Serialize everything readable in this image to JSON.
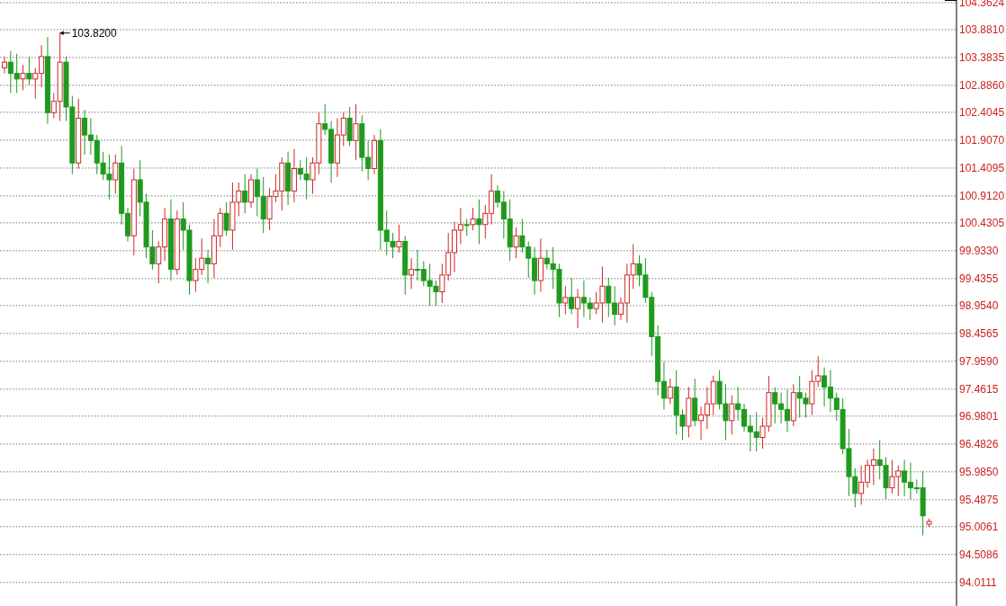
{
  "chart": {
    "chart_data": {
      "type": "candlestick",
      "grid": true,
      "ylim": [
        93.59,
        104.41
      ],
      "yticks": [
        {
          "value": 104.3624,
          "label": "104.3624"
        },
        {
          "value": 103.881,
          "label": "103.8810"
        },
        {
          "value": 103.3835,
          "label": "103.3835"
        },
        {
          "value": 102.886,
          "label": "102.8860"
        },
        {
          "value": 102.4045,
          "label": "102.4045"
        },
        {
          "value": 101.907,
          "label": "101.9070"
        },
        {
          "value": 101.4095,
          "label": "101.4095"
        },
        {
          "value": 100.912,
          "label": "100.9120"
        },
        {
          "value": 100.4305,
          "label": "100.4305"
        },
        {
          "value": 99.933,
          "label": "99.9330"
        },
        {
          "value": 99.4355,
          "label": "99.4355"
        },
        {
          "value": 98.954,
          "label": "98.9540"
        },
        {
          "value": 98.4565,
          "label": "98.4565"
        },
        {
          "value": 97.959,
          "label": "97.9590"
        },
        {
          "value": 97.4615,
          "label": "97.4615"
        },
        {
          "value": 96.9801,
          "label": "96.9801"
        },
        {
          "value": 96.4826,
          "label": "96.4826"
        },
        {
          "value": 95.985,
          "label": "95.9850"
        },
        {
          "value": 95.4875,
          "label": "95.4875"
        },
        {
          "value": 95.0061,
          "label": "95.0061"
        },
        {
          "value": 94.5086,
          "label": "94.5086"
        },
        {
          "value": 94.0111,
          "label": "94.0111"
        }
      ],
      "annotations": [
        {
          "text": "103.8200"
        }
      ],
      "ohlc": [
        [
          103.2,
          103.4,
          103.1,
          103.3
        ],
        [
          103.3,
          103.5,
          102.75,
          103.1
        ],
        [
          103.1,
          103.45,
          102.75,
          103.0
        ],
        [
          103.0,
          103.25,
          102.8,
          103.1
        ],
        [
          103.1,
          103.4,
          102.9,
          103.0
        ],
        [
          103.0,
          103.2,
          102.65,
          103.1
        ],
        [
          103.1,
          103.6,
          102.85,
          103.4
        ],
        [
          103.4,
          103.75,
          102.2,
          102.4
        ],
        [
          102.4,
          102.75,
          102.3,
          102.6
        ],
        [
          102.6,
          103.82,
          102.25,
          103.3
        ],
        [
          103.3,
          103.4,
          102.25,
          102.5
        ],
        [
          102.5,
          102.7,
          101.3,
          101.5
        ],
        [
          101.5,
          102.65,
          101.4,
          102.3
        ],
        [
          102.3,
          102.45,
          101.65,
          102.0
        ],
        [
          102.0,
          102.3,
          101.65,
          101.9
        ],
        [
          101.9,
          102.0,
          101.3,
          101.5
        ],
        [
          101.5,
          101.7,
          101.2,
          101.3
        ],
        [
          101.3,
          101.65,
          100.85,
          101.2
        ],
        [
          101.2,
          101.65,
          100.95,
          101.5
        ],
        [
          101.5,
          101.8,
          100.4,
          100.6
        ],
        [
          100.6,
          100.7,
          100.1,
          100.2
        ],
        [
          100.2,
          101.4,
          99.85,
          101.2
        ],
        [
          101.2,
          101.55,
          100.55,
          100.8
        ],
        [
          100.8,
          100.95,
          99.8,
          100.0
        ],
        [
          100.0,
          100.3,
          99.6,
          99.7
        ],
        [
          99.7,
          100.1,
          99.35,
          100.0
        ],
        [
          100.0,
          100.7,
          99.75,
          100.5
        ],
        [
          100.5,
          100.85,
          99.4,
          99.6
        ],
        [
          99.6,
          100.65,
          99.5,
          100.5
        ],
        [
          100.5,
          100.8,
          99.95,
          100.3
        ],
        [
          100.3,
          100.4,
          99.15,
          99.4
        ],
        [
          99.4,
          99.8,
          99.2,
          99.6
        ],
        [
          99.6,
          100.15,
          99.5,
          99.8
        ],
        [
          99.8,
          99.95,
          99.35,
          99.7
        ],
        [
          99.7,
          100.5,
          99.45,
          100.2
        ],
        [
          100.2,
          100.7,
          100.0,
          100.6
        ],
        [
          100.6,
          100.8,
          100.2,
          100.3
        ],
        [
          100.3,
          101.15,
          99.95,
          100.8
        ],
        [
          100.8,
          101.15,
          100.55,
          101.0
        ],
        [
          101.0,
          101.3,
          100.6,
          100.8
        ],
        [
          100.8,
          101.3,
          100.7,
          101.2
        ],
        [
          101.2,
          101.4,
          100.55,
          100.9
        ],
        [
          100.9,
          101.25,
          100.25,
          100.5
        ],
        [
          100.5,
          101.05,
          100.3,
          100.9
        ],
        [
          100.9,
          101.3,
          100.8,
          101.0
        ],
        [
          101.0,
          101.6,
          100.65,
          101.5
        ],
        [
          101.5,
          101.7,
          100.75,
          101.0
        ],
        [
          101.0,
          101.75,
          100.8,
          101.4
        ],
        [
          101.4,
          101.55,
          101.2,
          101.3
        ],
        [
          101.3,
          101.6,
          100.85,
          101.2
        ],
        [
          101.2,
          101.6,
          100.95,
          101.5
        ],
        [
          101.5,
          102.4,
          101.3,
          102.2
        ],
        [
          102.2,
          102.55,
          102.0,
          102.1
        ],
        [
          102.1,
          102.25,
          101.15,
          101.5
        ],
        [
          101.5,
          102.3,
          101.25,
          102.0
        ],
        [
          102.0,
          102.4,
          101.8,
          102.3
        ],
        [
          102.3,
          102.5,
          101.8,
          101.9
        ],
        [
          101.9,
          102.55,
          101.55,
          102.2
        ],
        [
          102.2,
          102.35,
          101.35,
          101.6
        ],
        [
          101.6,
          101.9,
          101.2,
          101.4
        ],
        [
          101.4,
          102.0,
          101.3,
          101.9
        ],
        [
          101.9,
          102.1,
          99.95,
          100.3
        ],
        [
          100.3,
          100.65,
          99.85,
          100.1
        ],
        [
          100.1,
          100.25,
          99.8,
          100.0
        ],
        [
          100.0,
          100.4,
          99.9,
          100.1
        ],
        [
          100.1,
          100.2,
          99.15,
          99.5
        ],
        [
          99.5,
          99.8,
          99.25,
          99.6
        ],
        [
          99.6,
          99.95,
          99.4,
          99.6
        ],
        [
          99.6,
          99.75,
          99.3,
          99.4
        ],
        [
          99.4,
          99.7,
          98.95,
          99.3
        ],
        [
          99.3,
          99.4,
          98.95,
          99.2
        ],
        [
          99.2,
          99.7,
          99.0,
          99.5
        ],
        [
          99.5,
          100.25,
          99.4,
          99.9
        ],
        [
          99.9,
          100.45,
          99.55,
          100.3
        ],
        [
          100.3,
          100.7,
          100.05,
          100.4
        ],
        [
          100.4,
          100.5,
          100.2,
          100.4
        ],
        [
          100.4,
          100.7,
          100.3,
          100.5
        ],
        [
          100.5,
          100.85,
          100.05,
          100.4
        ],
        [
          100.4,
          100.75,
          100.15,
          100.6
        ],
        [
          100.6,
          101.3,
          100.4,
          101.0
        ],
        [
          101.0,
          101.1,
          100.7,
          100.8
        ],
        [
          100.8,
          101.0,
          100.15,
          100.5
        ],
        [
          100.5,
          100.85,
          99.75,
          100.0
        ],
        [
          100.0,
          100.35,
          99.8,
          100.2
        ],
        [
          100.2,
          100.5,
          99.9,
          100.0
        ],
        [
          100.0,
          100.1,
          99.45,
          99.8
        ],
        [
          99.8,
          100.0,
          99.15,
          99.4
        ],
        [
          99.4,
          100.15,
          99.2,
          99.8
        ],
        [
          99.8,
          99.95,
          99.6,
          99.7
        ],
        [
          99.7,
          100.0,
          99.25,
          99.6
        ],
        [
          99.6,
          99.7,
          98.75,
          99.0
        ],
        [
          99.0,
          99.3,
          98.8,
          99.1
        ],
        [
          99.1,
          99.45,
          98.8,
          98.9
        ],
        [
          98.9,
          99.25,
          98.55,
          99.1
        ],
        [
          99.1,
          99.4,
          98.75,
          99.0
        ],
        [
          99.0,
          99.1,
          98.7,
          98.9
        ],
        [
          98.9,
          99.2,
          98.8,
          99.0
        ],
        [
          99.0,
          99.65,
          98.65,
          99.3
        ],
        [
          99.3,
          99.45,
          98.75,
          99.0
        ],
        [
          99.0,
          99.3,
          98.6,
          98.8
        ],
        [
          98.8,
          99.1,
          98.7,
          99.0
        ],
        [
          99.0,
          99.7,
          98.65,
          99.5
        ],
        [
          99.5,
          100.05,
          99.25,
          99.7
        ],
        [
          99.7,
          99.85,
          99.3,
          99.5
        ],
        [
          99.5,
          99.8,
          99.0,
          99.1
        ],
        [
          99.1,
          99.2,
          98.05,
          98.4
        ],
        [
          98.4,
          98.6,
          97.35,
          97.6
        ],
        [
          97.6,
          97.95,
          97.1,
          97.3
        ],
        [
          97.3,
          97.65,
          97.2,
          97.5
        ],
        [
          97.5,
          97.8,
          96.65,
          97.0
        ],
        [
          97.0,
          97.1,
          96.55,
          96.8
        ],
        [
          96.8,
          97.5,
          96.6,
          97.3
        ],
        [
          97.3,
          97.65,
          96.8,
          96.9
        ],
        [
          96.9,
          97.15,
          96.55,
          97.0
        ],
        [
          97.0,
          97.5,
          96.75,
          97.2
        ],
        [
          97.2,
          97.7,
          97.0,
          97.6
        ],
        [
          97.6,
          97.8,
          97.1,
          97.2
        ],
        [
          97.2,
          97.55,
          96.55,
          96.9
        ],
        [
          96.9,
          97.35,
          96.65,
          97.2
        ],
        [
          97.2,
          97.5,
          96.9,
          97.1
        ],
        [
          97.1,
          97.2,
          96.7,
          96.8
        ],
        [
          96.8,
          97.0,
          96.35,
          96.7
        ],
        [
          96.7,
          97.05,
          96.35,
          96.6
        ],
        [
          96.6,
          96.95,
          96.4,
          96.8
        ],
        [
          96.8,
          97.7,
          96.7,
          97.4
        ],
        [
          97.4,
          97.5,
          96.85,
          97.2
        ],
        [
          97.2,
          97.4,
          96.85,
          97.1
        ],
        [
          97.1,
          97.45,
          96.7,
          96.9
        ],
        [
          96.9,
          97.55,
          96.8,
          97.4
        ],
        [
          97.4,
          97.7,
          96.95,
          97.3
        ],
        [
          97.3,
          97.4,
          96.95,
          97.2
        ],
        [
          97.2,
          97.8,
          97.0,
          97.6
        ],
        [
          97.6,
          98.05,
          97.5,
          97.7
        ],
        [
          97.7,
          97.85,
          97.15,
          97.5
        ],
        [
          97.5,
          97.8,
          97.05,
          97.3
        ],
        [
          97.3,
          97.4,
          96.9,
          97.1
        ],
        [
          97.1,
          97.3,
          96.3,
          96.4
        ],
        [
          96.4,
          96.75,
          95.55,
          95.9
        ],
        [
          95.9,
          96.05,
          95.35,
          95.6
        ],
        [
          95.6,
          96.1,
          95.4,
          95.8
        ],
        [
          95.8,
          96.2,
          95.7,
          96.1
        ],
        [
          96.1,
          96.4,
          95.75,
          96.2
        ],
        [
          96.2,
          96.55,
          95.85,
          96.1
        ],
        [
          96.1,
          96.25,
          95.5,
          95.7
        ],
        [
          95.7,
          96.2,
          95.6,
          95.9
        ],
        [
          95.9,
          96.1,
          95.55,
          96.0
        ],
        [
          96.0,
          96.2,
          95.55,
          95.8
        ],
        [
          95.8,
          96.15,
          95.5,
          95.7
        ],
        [
          95.7,
          95.85,
          95.6,
          95.7
        ],
        [
          95.7,
          96.0,
          94.85,
          95.2
        ],
        [
          95.05,
          95.15,
          95.0,
          95.1
        ]
      ]
    }
  }
}
